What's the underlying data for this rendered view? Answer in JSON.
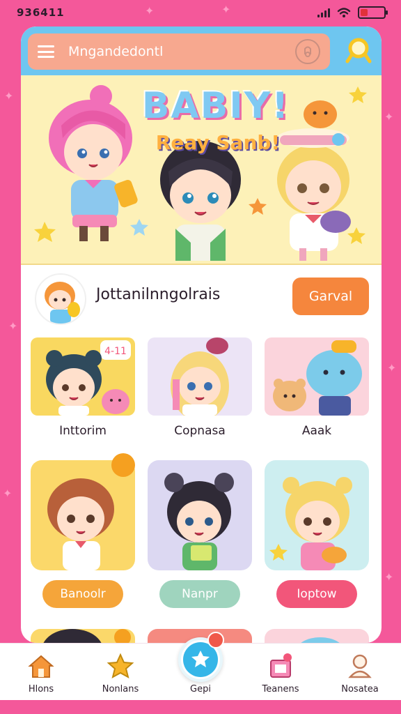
{
  "status_bar": {
    "time": "936411"
  },
  "search": {
    "placeholder": "Mngandedontl"
  },
  "banner": {
    "title": "BABIY!",
    "subtitle": "Reay Sanb!"
  },
  "profile": {
    "name": "Jottanilnngolrais",
    "cancel_label": "Garval"
  },
  "cards": [
    {
      "label": "Inttorim",
      "bg": "#f9d860",
      "bubble": "4-11"
    },
    {
      "label": "Copnasa",
      "bg": "#ece4f6"
    },
    {
      "label": "Aaak",
      "bg": "#fbd4dc"
    }
  ],
  "tiles": [
    {
      "bg": "#fbd86a",
      "button_label": "Banoolr",
      "button_color": "#f5a53a",
      "has_badge": true
    },
    {
      "bg": "#dcd8f2",
      "button_label": "Nanpr",
      "button_color": "#9fd4be",
      "has_badge": false
    },
    {
      "bg": "#cdeef0",
      "button_label": "Ioptow",
      "button_color": "#f2567a",
      "has_badge": false
    }
  ],
  "bottom_nav": {
    "items": [
      {
        "label": "Hlons",
        "icon": "home-icon",
        "color": "#f5963a"
      },
      {
        "label": "Nonlans",
        "icon": "star-icon",
        "color": "#f7b42a"
      },
      {
        "label": "Gepi",
        "icon": "star-circle-icon",
        "color": "#35b6e8"
      },
      {
        "label": "Teanens",
        "icon": "gift-icon",
        "color": "#f2567a"
      },
      {
        "label": "Nosatea",
        "icon": "person-icon",
        "color": "#d07d5a"
      }
    ]
  },
  "colors": {
    "background": "#f4589a",
    "header": "#6ec6f0",
    "search_bar": "#f7a88f",
    "accent_orange": "#f5863d"
  }
}
